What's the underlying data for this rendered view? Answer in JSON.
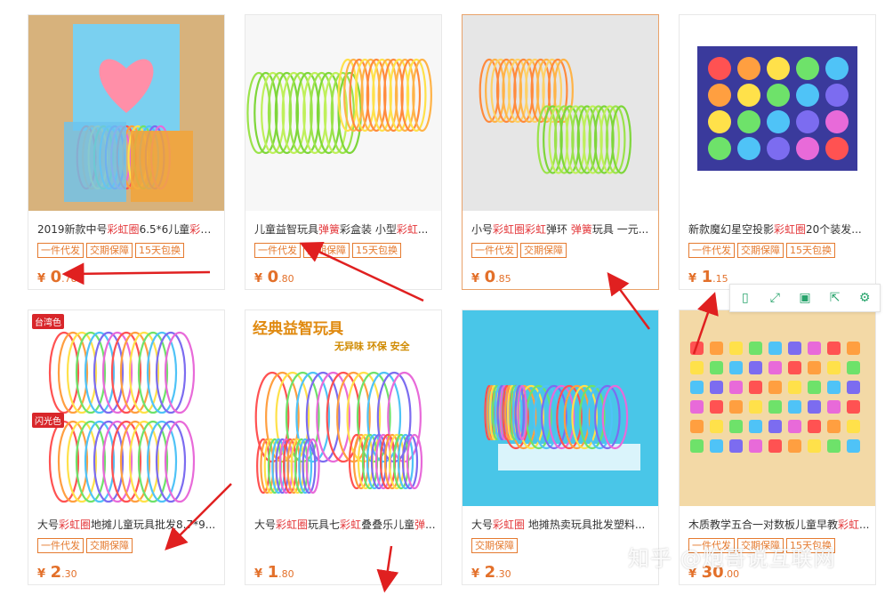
{
  "products": [
    {
      "title_parts": [
        {
          "t": "2019新款中号"
        },
        {
          "t": "彩虹圈",
          "hl": true
        },
        {
          "t": "6.5*6儿童"
        },
        {
          "t": "彩虹",
          "hl": true
        },
        {
          "t": "..."
        }
      ],
      "tags": [
        "一件代发",
        "交期保障",
        "15天包换"
      ],
      "price_int": "0",
      "price_dec": ".78"
    },
    {
      "title_parts": [
        {
          "t": "儿童益智玩具"
        },
        {
          "t": "弹簧",
          "hl": true
        },
        {
          "t": "彩盒装 小型"
        },
        {
          "t": "彩虹",
          "hl": true
        },
        {
          "t": "..."
        }
      ],
      "tags": [
        "一件代发",
        "交期保障",
        "15天包换"
      ],
      "price_int": "0",
      "price_dec": ".80"
    },
    {
      "title_parts": [
        {
          "t": "小号"
        },
        {
          "t": "彩虹圈彩虹",
          "hl": true
        },
        {
          "t": "弹环 "
        },
        {
          "t": "弹簧",
          "hl": true
        },
        {
          "t": "玩具 一元..."
        }
      ],
      "tags": [
        "一件代发",
        "交期保障"
      ],
      "price_int": "0",
      "price_dec": ".85"
    },
    {
      "title_parts": [
        {
          "t": "新款魔幻星空投影"
        },
        {
          "t": "彩虹圈",
          "hl": true
        },
        {
          "t": "20个装发..."
        }
      ],
      "tags": [
        "一件代发",
        "交期保障",
        "15天包换"
      ],
      "price_int": "1",
      "price_dec": ".15"
    },
    {
      "title_parts": [
        {
          "t": "大号"
        },
        {
          "t": "彩虹圈",
          "hl": true
        },
        {
          "t": "地摊儿童玩具批发8.7*9..."
        }
      ],
      "tags": [
        "一件代发",
        "交期保障"
      ],
      "price_int": "2",
      "price_dec": ".30"
    },
    {
      "title_parts": [
        {
          "t": "大号"
        },
        {
          "t": "彩虹圈",
          "hl": true
        },
        {
          "t": "玩具七"
        },
        {
          "t": "彩虹",
          "hl": true
        },
        {
          "t": "叠叠乐儿童"
        },
        {
          "t": "弹",
          "hl": true
        },
        {
          "t": "..."
        }
      ],
      "tags": [],
      "price_int": "1",
      "price_dec": ".80"
    },
    {
      "title_parts": [
        {
          "t": "大号"
        },
        {
          "t": "彩虹圈",
          "hl": true
        },
        {
          "t": " 地摊热卖玩具批发塑料..."
        }
      ],
      "tags": [
        "交期保障"
      ],
      "price_int": "2",
      "price_dec": ".30"
    },
    {
      "title_parts": [
        {
          "t": "木质教学五合一对数板儿童早教"
        },
        {
          "t": "彩虹",
          "hl": true
        },
        {
          "t": "..."
        }
      ],
      "tags": [
        "一件代发",
        "交期保障",
        "15天包换"
      ],
      "price_int": "30",
      "price_dec": ".00"
    }
  ],
  "currency": "¥",
  "img6_headline": "经典益智玩具",
  "img6_sub": "无异味  环保  安全",
  "badge_top": "台湾色",
  "badge_bottom": "闪光色",
  "watermark": "知乎 @炮哥说互联网",
  "toolbar_icons": [
    "phone-icon",
    "expand-icon",
    "save-icon",
    "share-icon",
    "gear-icon"
  ]
}
